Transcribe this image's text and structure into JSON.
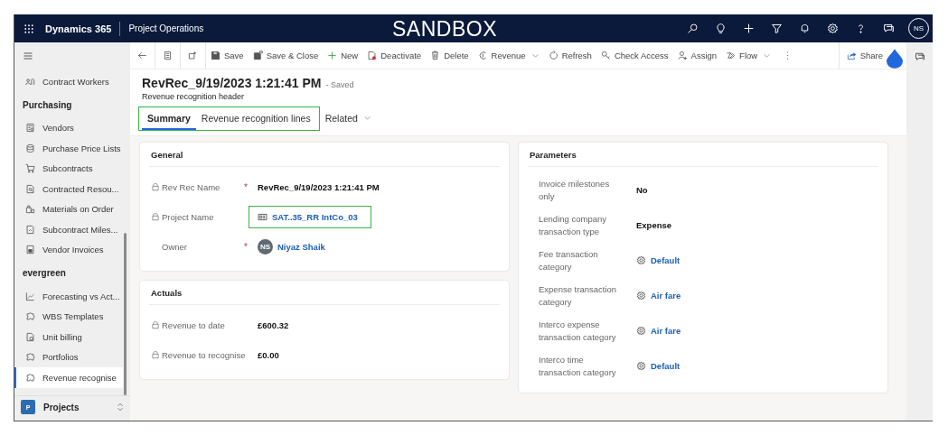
{
  "top_bar": {
    "app_name": "Dynamics 365",
    "area_name": "Project Operations",
    "environment_label": "SANDBOX",
    "avatar_initials": "NS"
  },
  "sidebar": {
    "sections": [
      {
        "items": [
          {
            "label": "Contract Workers",
            "selected": false
          }
        ]
      },
      {
        "title": "Purchasing",
        "items": [
          {
            "label": "Vendors",
            "selected": false
          },
          {
            "label": "Purchase Price Lists",
            "selected": false
          },
          {
            "label": "Subcontracts",
            "selected": false
          },
          {
            "label": "Contracted Resou...",
            "selected": false
          },
          {
            "label": "Materials on Order",
            "selected": false
          },
          {
            "label": "Subcontract Miles...",
            "selected": false
          },
          {
            "label": "Vendor Invoices",
            "selected": false
          }
        ]
      },
      {
        "title": "evergreen",
        "items": [
          {
            "label": "Forecasting vs Act...",
            "selected": false
          },
          {
            "label": "WBS Templates",
            "selected": false
          },
          {
            "label": "Unit billing",
            "selected": false
          },
          {
            "label": "Portfolios",
            "selected": false
          },
          {
            "label": "Revenue recognise",
            "selected": true
          }
        ]
      }
    ],
    "area_switcher": {
      "badge": "P",
      "label": "Projects"
    }
  },
  "commands": [
    {
      "label": "Save",
      "dropdown": false
    },
    {
      "label": "Save & Close",
      "dropdown": false
    },
    {
      "label": "New",
      "dropdown": false
    },
    {
      "label": "Deactivate",
      "dropdown": false
    },
    {
      "label": "Delete",
      "dropdown": false
    },
    {
      "label": "Revenue",
      "dropdown": true
    },
    {
      "label": "Refresh",
      "dropdown": false
    },
    {
      "label": "Check Access",
      "dropdown": false
    },
    {
      "label": "Assign",
      "dropdown": false
    },
    {
      "label": "Flow",
      "dropdown": true
    }
  ],
  "share": {
    "label": "Share"
  },
  "record": {
    "title": "RevRec_9/19/2023 1:21:41 PM",
    "status": "- Saved",
    "entity": "Revenue recognition header"
  },
  "tabs": [
    {
      "label": "Summary",
      "selected": true,
      "highlighted": true,
      "dropdown": false
    },
    {
      "label": "Revenue recognition lines",
      "selected": false,
      "highlighted": true,
      "dropdown": false
    },
    {
      "label": "Related",
      "selected": false,
      "highlighted": false,
      "dropdown": true
    }
  ],
  "columns": [
    {
      "sections": [
        {
          "title": "General",
          "fields": [
            {
              "label": "Rev Rec Name",
              "locked": true,
              "required_mark": "*",
              "kind": "text",
              "value": "RevRec_9/19/2023 1:21:41 PM",
              "highlighted": false
            },
            {
              "label": "Project Name",
              "locked": true,
              "kind": "link",
              "value": "SAT..35_RR IntCo_03",
              "highlighted": true
            },
            {
              "label": "Owner",
              "locked": false,
              "required_mark": "*",
              "kind": "user",
              "avatar_initials": "NS",
              "value": "Niyaz Shaik",
              "highlighted": false
            }
          ]
        },
        {
          "title": "Actuals",
          "fields": [
            {
              "label": "Revenue to date",
              "locked": true,
              "kind": "text",
              "value": "£600.32",
              "highlighted": false
            },
            {
              "label": "Revenue to recognise",
              "locked": true,
              "kind": "text",
              "value": "£0.00",
              "highlighted": false
            }
          ]
        }
      ]
    },
    {
      "sections": [
        {
          "title": "Parameters",
          "fields": [
            {
              "label": "Invoice milestones only",
              "locked": false,
              "kind": "text",
              "value": "No",
              "highlighted": false
            },
            {
              "label": "Lending company transaction type",
              "locked": false,
              "kind": "text",
              "value": "Expense",
              "highlighted": false
            },
            {
              "label": "Fee transaction category",
              "locked": false,
              "kind": "lookup",
              "value": "Default",
              "highlighted": false
            },
            {
              "label": "Expense transaction category",
              "locked": false,
              "kind": "lookup",
              "value": "Air fare",
              "highlighted": false
            },
            {
              "label": "Interco expense transaction category",
              "locked": false,
              "kind": "lookup",
              "value": "Air fare",
              "highlighted": false
            },
            {
              "label": "Interco time transaction category",
              "locked": false,
              "kind": "lookup",
              "value": "Default",
              "highlighted": false
            }
          ]
        }
      ]
    }
  ]
}
